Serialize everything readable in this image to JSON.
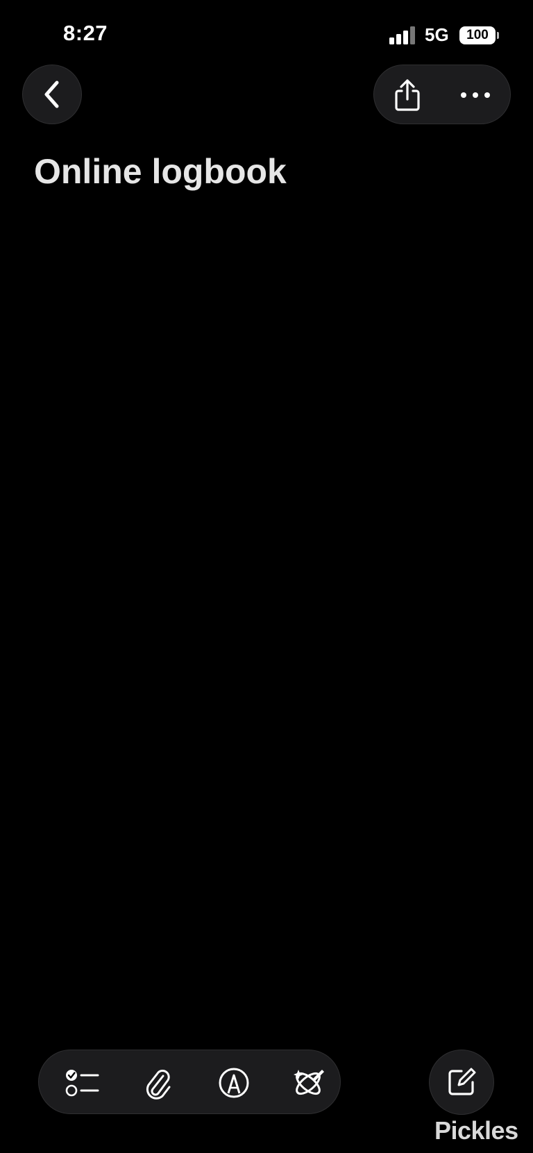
{
  "status_bar": {
    "time": "8:27",
    "network": "5G",
    "battery": "100"
  },
  "icons": {
    "back": "chevron-left-icon",
    "share": "share-icon",
    "more": "ellipsis-icon",
    "checklist": "checklist-icon",
    "attach": "paperclip-icon",
    "markup": "pen-tip-circle-icon",
    "ai": "sparkle-pen-icon",
    "compose": "compose-icon"
  },
  "note": {
    "title": "Online logbook"
  },
  "watermark": "Pickles",
  "colors": {
    "background": "#000000",
    "pill": "#1c1c1e",
    "title": "#e6e6e6"
  }
}
